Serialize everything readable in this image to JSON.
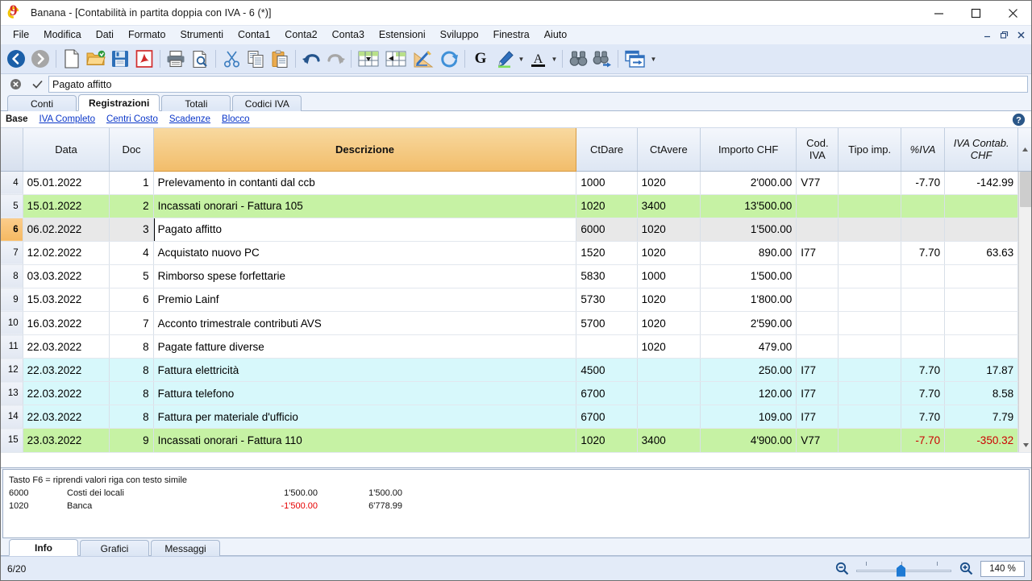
{
  "window": {
    "title": "Banana - [Contabilità in partita doppia con IVA - 6 (*)]",
    "logo_char": "9",
    "minimize": "minimize-icon",
    "maximize": "maximize-icon",
    "close": "close-icon"
  },
  "menu": {
    "items": [
      "File",
      "Modifica",
      "Dati",
      "Formato",
      "Strumenti",
      "Conta1",
      "Conta2",
      "Conta3",
      "Estensioni",
      "Sviluppo",
      "Finestra",
      "Aiuto"
    ],
    "mdi": [
      "minimize",
      "restore",
      "close"
    ]
  },
  "toolbar": {
    "items": [
      "back-icon",
      "forward-icon",
      "new-file-icon",
      "open-folder-icon",
      "save-icon",
      "pdf-icon",
      "print-icon",
      "print-preview-icon",
      "cut-icon",
      "copy-icon",
      "paste-icon",
      "undo-icon",
      "redo-icon",
      "insert-row-icon",
      "delete-row-icon",
      "formula-chart-icon",
      "refresh-icon",
      "bold-icon",
      "highlight-color-icon",
      "font-color-icon",
      "find-icon",
      "find-replace-icon",
      "open-window-icon"
    ]
  },
  "formula_bar": {
    "cancel_icon": "cancel-icon",
    "accept_icon": "accept-icon",
    "value": "Pagato affitto",
    "placeholder": ""
  },
  "tabs": {
    "items": [
      {
        "label": "Conti",
        "active": false
      },
      {
        "label": "Registrazioni",
        "active": true
      },
      {
        "label": "Totali",
        "active": false
      },
      {
        "label": "Codici IVA",
        "active": false
      }
    ]
  },
  "subtabs": {
    "items": [
      {
        "label": "Base",
        "active": true
      },
      {
        "label": "IVA Completo",
        "active": false
      },
      {
        "label": "Centri Costo",
        "active": false
      },
      {
        "label": "Scadenze",
        "active": false
      },
      {
        "label": "Blocco",
        "active": false
      }
    ],
    "help_icon": "help-icon"
  },
  "grid": {
    "columns": [
      {
        "label": "Data",
        "align": "c-center",
        "active": false
      },
      {
        "label": "Doc",
        "align": "c-center",
        "active": false
      },
      {
        "label": "Descrizione",
        "align": "c-center",
        "active": true
      },
      {
        "label": "CtDare",
        "align": "c-center",
        "active": false
      },
      {
        "label": "CtAvere",
        "align": "c-center",
        "active": false
      },
      {
        "label": "Importo CHF",
        "align": "c-center",
        "active": false
      },
      {
        "label": "Cod. IVA",
        "align": "c-center",
        "active": false
      },
      {
        "label": "Tipo imp.",
        "align": "c-center",
        "active": false
      },
      {
        "label": "%IVA",
        "align": "c-center",
        "active": false,
        "italic": true
      },
      {
        "label": "IVA Contab. CHF",
        "align": "c-center",
        "active": false,
        "italic": true
      }
    ],
    "rows": [
      {
        "n": "4",
        "state": "normal",
        "data": "05.01.2022",
        "doc": "1",
        "desc": "Prelevamento in contanti dal ccb",
        "ctdare": "1000",
        "ctavere": "1020",
        "importo": "2'000.00",
        "codiva": "V77",
        "tipoimp": "",
        "iva": "-7.70",
        "ivacontab": "-142.99",
        "iva_neg": true,
        "ivacontab_neg": true
      },
      {
        "n": "5",
        "state": "green",
        "data": "15.01.2022",
        "doc": "2",
        "desc": "Incassati onorari - Fattura 105",
        "ctdare": "1020",
        "ctavere": "3400",
        "importo": "13'500.00",
        "codiva": "",
        "tipoimp": "",
        "iva": "",
        "ivacontab": "",
        "iva_neg": false,
        "ivacontab_neg": false
      },
      {
        "n": "6",
        "state": "sel",
        "data": "06.02.2022",
        "doc": "3",
        "desc": "Pagato affitto",
        "ctdare": "6000",
        "ctavere": "1020",
        "importo": "1'500.00",
        "codiva": "",
        "tipoimp": "",
        "iva": "",
        "ivacontab": "",
        "iva_neg": false,
        "ivacontab_neg": false,
        "editing": true
      },
      {
        "n": "7",
        "state": "normal",
        "data": "12.02.2022",
        "doc": "4",
        "desc": "Acquistato nuovo PC",
        "ctdare": "1520",
        "ctavere": "1020",
        "importo": "890.00",
        "codiva": "I77",
        "tipoimp": "",
        "iva": "7.70",
        "ivacontab": "63.63",
        "iva_neg": false,
        "ivacontab_neg": false
      },
      {
        "n": "8",
        "state": "normal",
        "data": "03.03.2022",
        "doc": "5",
        "desc": "Rimborso spese forfettarie",
        "ctdare": "5830",
        "ctavere": "1000",
        "importo": "1'500.00",
        "codiva": "",
        "tipoimp": "",
        "iva": "",
        "ivacontab": "",
        "iva_neg": false,
        "ivacontab_neg": false
      },
      {
        "n": "9",
        "state": "normal",
        "data": "15.03.2022",
        "doc": "6",
        "desc": "Premio Lainf",
        "ctdare": "5730",
        "ctavere": "1020",
        "importo": "1'800.00",
        "codiva": "",
        "tipoimp": "",
        "iva": "",
        "ivacontab": "",
        "iva_neg": false,
        "ivacontab_neg": false
      },
      {
        "n": "10",
        "state": "normal",
        "data": "16.03.2022",
        "doc": "7",
        "desc": "Acconto trimestrale contributi AVS",
        "ctdare": "5700",
        "ctavere": "1020",
        "importo": "2'590.00",
        "codiva": "",
        "tipoimp": "",
        "iva": "",
        "ivacontab": "",
        "iva_neg": false,
        "ivacontab_neg": false
      },
      {
        "n": "11",
        "state": "normal",
        "data": "22.03.2022",
        "doc": "8",
        "desc": "Pagate fatture diverse",
        "ctdare": "",
        "ctavere": "1020",
        "importo": "479.00",
        "codiva": "",
        "tipoimp": "",
        "iva": "",
        "ivacontab": "",
        "iva_neg": false,
        "ivacontab_neg": false
      },
      {
        "n": "12",
        "state": "cyan",
        "data": "22.03.2022",
        "doc": "8",
        "desc": "Fattura elettricità",
        "ctdare": "4500",
        "ctavere": "",
        "importo": "250.00",
        "codiva": "I77",
        "tipoimp": "",
        "iva": "7.70",
        "ivacontab": "17.87",
        "iva_neg": false,
        "ivacontab_neg": false
      },
      {
        "n": "13",
        "state": "cyan",
        "data": "22.03.2022",
        "doc": "8",
        "desc": "Fattura telefono",
        "ctdare": "6700",
        "ctavere": "",
        "importo": "120.00",
        "codiva": "I77",
        "tipoimp": "",
        "iva": "7.70",
        "ivacontab": "8.58",
        "iva_neg": false,
        "ivacontab_neg": false
      },
      {
        "n": "14",
        "state": "cyan",
        "data": "22.03.2022",
        "doc": "8",
        "desc": "Fattura per materiale d'ufficio",
        "ctdare": "6700",
        "ctavere": "",
        "importo": "109.00",
        "codiva": "I77",
        "tipoimp": "",
        "iva": "7.70",
        "ivacontab": "7.79",
        "iva_neg": false,
        "ivacontab_neg": false
      },
      {
        "n": "15",
        "state": "green",
        "data": "23.03.2022",
        "doc": "9",
        "desc": "Incassati onorari - Fattura 110",
        "ctdare": "1020",
        "ctavere": "3400",
        "importo": "4'900.00",
        "codiva": "V77",
        "tipoimp": "",
        "iva": "-7.70",
        "ivacontab": "-350.32",
        "iva_neg": true,
        "ivacontab_neg": true
      }
    ],
    "editing_cell_value": "Pagato affitto"
  },
  "info_panel": {
    "hint": "Tasto F6 = riprendi valori riga con testo simile",
    "lines": [
      {
        "account": "6000",
        "description": "Costi dei locali",
        "amount": "1'500.00",
        "balance": "1'500.00",
        "amount_neg": false
      },
      {
        "account": "1020",
        "description": "Banca",
        "amount": "-1'500.00",
        "balance": "6'778.99",
        "amount_neg": true
      }
    ]
  },
  "bottom_tabs": {
    "items": [
      {
        "label": "Info",
        "active": true
      },
      {
        "label": "Grafici",
        "active": false
      },
      {
        "label": "Messaggi",
        "active": false
      }
    ]
  },
  "status_bar": {
    "position": "6/20",
    "zoom_out_icon": "zoom-out-icon",
    "zoom_in_icon": "zoom-in-icon",
    "zoom_value": "140 %"
  },
  "colors": {
    "accent_orange": "#f2bd6b",
    "row_green": "#c6f2a4",
    "row_cyan": "#d7f8fb",
    "row_selected": "#e8e8e8",
    "negative_red": "#e60000",
    "link_blue": "#0a36c9",
    "chrome_blue": "#dfe8f7"
  }
}
